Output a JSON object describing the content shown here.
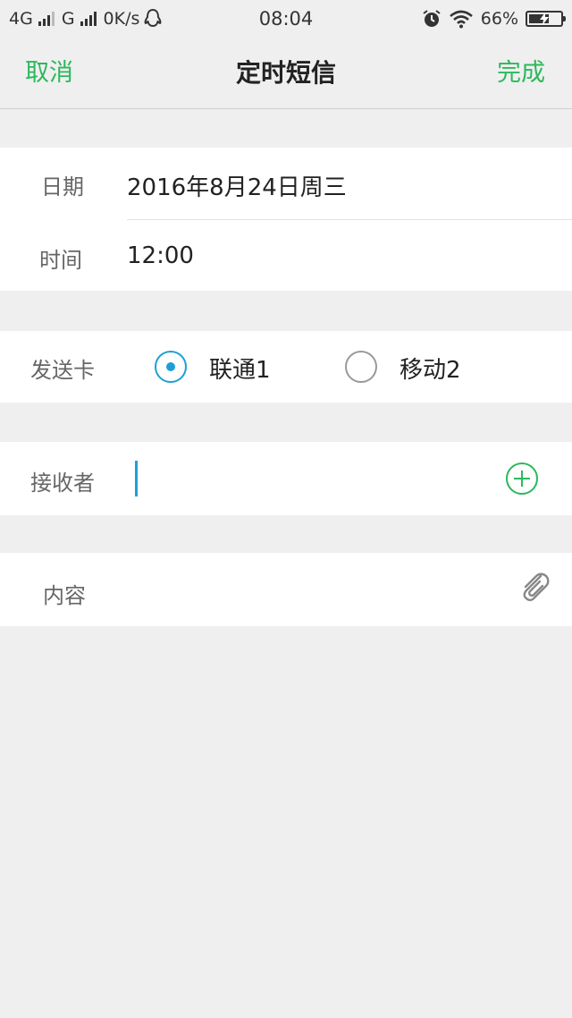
{
  "status_bar": {
    "net1": "4G",
    "net2": "G",
    "speed": "0K/s",
    "time": "08:04",
    "battery": "66%",
    "battery_level": 0.66
  },
  "nav": {
    "cancel_label": "取消",
    "title": "定时短信",
    "done_label": "完成"
  },
  "schedule": {
    "date_label": "日期",
    "date_value": "2016年8月24日周三",
    "time_label": "时间",
    "time_value": "12:00"
  },
  "sim": {
    "label": "发送卡",
    "options": [
      {
        "label": "联通1",
        "selected": true
      },
      {
        "label": "移动2",
        "selected": false
      }
    ]
  },
  "recipient": {
    "label": "接收者",
    "value": ""
  },
  "content": {
    "label": "内容"
  },
  "colors": {
    "accent_green": "#2db85c",
    "accent_blue": "#1d9fd6",
    "background": "#efefef"
  },
  "icons": [
    "signal-icon",
    "qq-icon",
    "alarm-icon",
    "wifi-icon",
    "battery-icon",
    "add-recipient-icon",
    "paperclip-icon"
  ]
}
